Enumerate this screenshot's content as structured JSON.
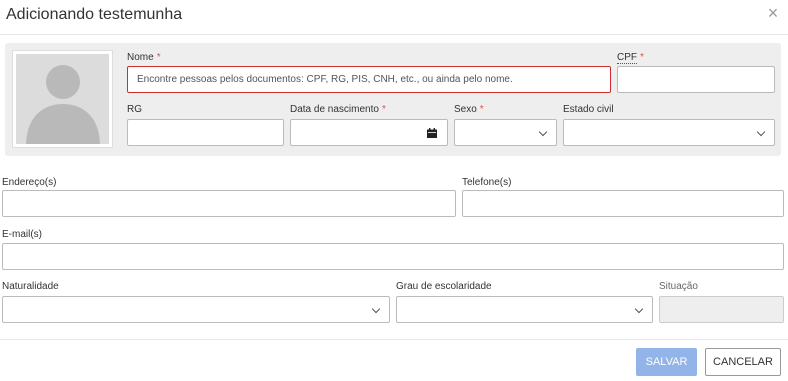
{
  "dialog": {
    "title": "Adicionando testemunha",
    "close_icon": "close-icon"
  },
  "person": {
    "photo_icon": "avatar-placeholder-icon",
    "nome_label": "Nome",
    "nome_required": "*",
    "nome_placeholder": "Encontre pessoas pelos documentos: CPF, RG, PIS, CNH, etc., ou ainda pelo nome.",
    "cpf_label": "CPF",
    "cpf_required": "*",
    "cpf_value": "",
    "rg_label": "RG",
    "rg_value": "",
    "nascimento_label": "Data de nascimento",
    "nascimento_required": "*",
    "nascimento_value": "",
    "calendar_icon": "calendar-icon",
    "sexo_label": "Sexo",
    "sexo_required": "*",
    "sexo_value": "",
    "estado_civil_label": "Estado civil",
    "estado_civil_value": ""
  },
  "contact": {
    "endereco_label": "Endereço(s)",
    "endereco_value": "",
    "telefone_label": "Telefone(s)",
    "telefone_value": "",
    "email_label": "E-mail(s)",
    "email_value": ""
  },
  "extra": {
    "naturalidade_label": "Naturalidade",
    "naturalidade_value": "",
    "escolaridade_label": "Grau de escolaridade",
    "escolaridade_value": "",
    "situacao_label": "Situação",
    "situacao_value": ""
  },
  "footer": {
    "save_label": "SALVAR",
    "cancel_label": "CANCELAR"
  },
  "colors": {
    "required": "#d9534f",
    "error_border": "#c9302c",
    "save_button": "#93b4e8",
    "panel_bg": "#eeeeee"
  }
}
